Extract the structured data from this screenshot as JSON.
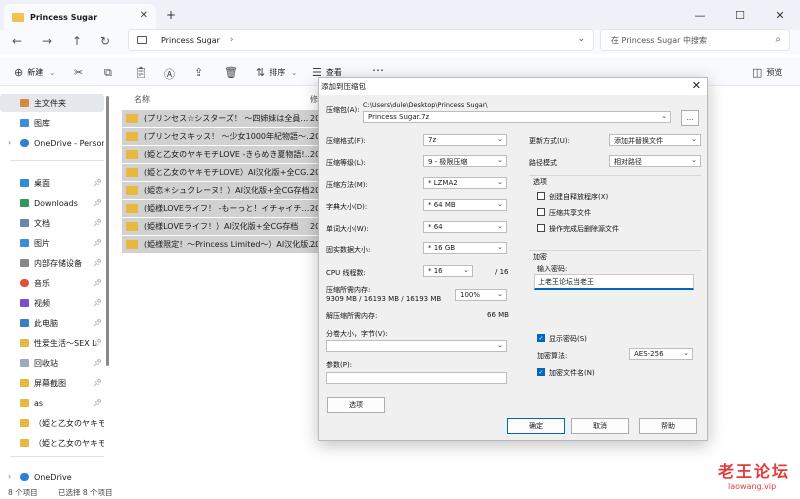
{
  "window": {
    "tab_title": "Princess Sugar",
    "search_placeholder": "在 Princess Sugar 中搜索",
    "breadcrumb": "Princess Sugar"
  },
  "toolbar": {
    "new_label": "新建",
    "sort_label": "排序",
    "view_label": "查看",
    "preview_label": "预览"
  },
  "sidebar": {
    "items": [
      {
        "label": "主文件夹",
        "icon": "home-icon"
      },
      {
        "label": "图库",
        "icon": "gallery-icon"
      },
      {
        "label": "OneDrive - Persona",
        "icon": "cloud-icon"
      },
      {
        "label": "桌面",
        "icon": "desktop-icon"
      },
      {
        "label": "Downloads",
        "icon": "download-icon"
      },
      {
        "label": "文档",
        "icon": "document-icon"
      },
      {
        "label": "图片",
        "icon": "picture-icon"
      },
      {
        "label": "内部存储设备",
        "icon": "drive-icon"
      },
      {
        "label": "音乐",
        "icon": "music-icon"
      },
      {
        "label": "视频",
        "icon": "video-icon"
      },
      {
        "label": "此电脑",
        "icon": "computer-icon"
      },
      {
        "label": "性爱生活～SEX L",
        "icon": "folder-icon"
      },
      {
        "label": "回收站",
        "icon": "recycle-bin-icon"
      },
      {
        "label": "屏幕截图",
        "icon": "folder-icon"
      },
      {
        "label": "as",
        "icon": "folder-icon"
      },
      {
        "label": "（姫と乙女のヤキモ",
        "icon": "folder-icon"
      },
      {
        "label": "（姫と乙女のヤキモ",
        "icon": "folder-icon"
      },
      {
        "label": "OneDrive",
        "icon": "cloud-icon"
      }
    ]
  },
  "files": {
    "col_name": "名称",
    "col_date": "修",
    "rows": [
      {
        "name": "(プリンセス☆シスターズ！ ～四姉妹は全員…",
        "date": "20"
      },
      {
        "name": "(プリンセスキッス！ ～少女1000年紀物語～…",
        "date": "20"
      },
      {
        "name": "(姫と乙女のヤキモチLOVE -きらめき夏物語!…",
        "date": "20"
      },
      {
        "name": "(姫と乙女のヤキモチLOVE）AI汉化版+全CG…",
        "date": "20"
      },
      {
        "name": "(姫恋＊シュクレーヌ！）AI汉化版+全CG存档",
        "date": "20"
      },
      {
        "name": "(姫様LOVEライフ！ -もーっと！イチャイチ…",
        "date": "20"
      },
      {
        "name": "(姫様LOVEライフ！）AI汉化版+全CG存档",
        "date": "20"
      },
      {
        "name": "(姫様限定！～Princess Limited～）AI汉化版…",
        "date": "20"
      }
    ]
  },
  "status": {
    "count": "8 个项目",
    "selected": "已选择 8 个项目"
  },
  "dialog": {
    "title": "添加到压缩包",
    "archive_label": "压缩包(A):",
    "archive_path": "C:\\Users\\dule\\Desktop\\Princess Sugar\\",
    "archive_name": "Princess Sugar.7z",
    "browse_label": "...",
    "format_label": "压缩格式(F):",
    "format_value": "7z",
    "level_label": "压缩等级(L):",
    "level_value": "9 - 极限压缩",
    "method_label": "压缩方法(M):",
    "method_value": "* LZMA2",
    "dict_label": "字典大小(D):",
    "dict_value": "* 64 MB",
    "word_label": "单词大小(W):",
    "word_value": "* 64",
    "solid_label": "固实数据大小:",
    "solid_value": "* 16 GB",
    "threads_label": "CPU 线程数:",
    "threads_value": "* 16",
    "threads_max": "/ 16",
    "mem_label": "压缩所需内存:",
    "mem_value": "9309 MB / 16193 MB / 16193 MB",
    "mem_percent": "100%",
    "decomp_label": "解压缩所需内存:",
    "decomp_value": "66 MB",
    "split_label": "分卷大小，字节(V):",
    "params_label": "参数(P):",
    "options_button": "选项",
    "update_label": "更新方式(U):",
    "update_value": "添加并替换文件",
    "path_label": "路径模式",
    "path_value": "相对路径",
    "options_group": "选项",
    "opt_sfx": "创建自释放程序(X)",
    "opt_shared": "压缩共享文件",
    "opt_delete": "操作完成后删除源文件",
    "encrypt_group": "加密",
    "password_label": "输入密码:",
    "password_value": "上老王论坛当老王",
    "show_password": "显示密码(S)",
    "enc_method_label": "加密算法:",
    "enc_method_value": "AES-256",
    "encrypt_names": "加密文件名(N)",
    "ok": "确定",
    "cancel": "取消",
    "help": "帮助"
  },
  "watermark": {
    "line1": "老王论坛",
    "line2": "laowang.vip"
  },
  "colors": {
    "accent": "#0067c0",
    "selection": "#d1d1d1",
    "folder": "#e9b93f"
  }
}
